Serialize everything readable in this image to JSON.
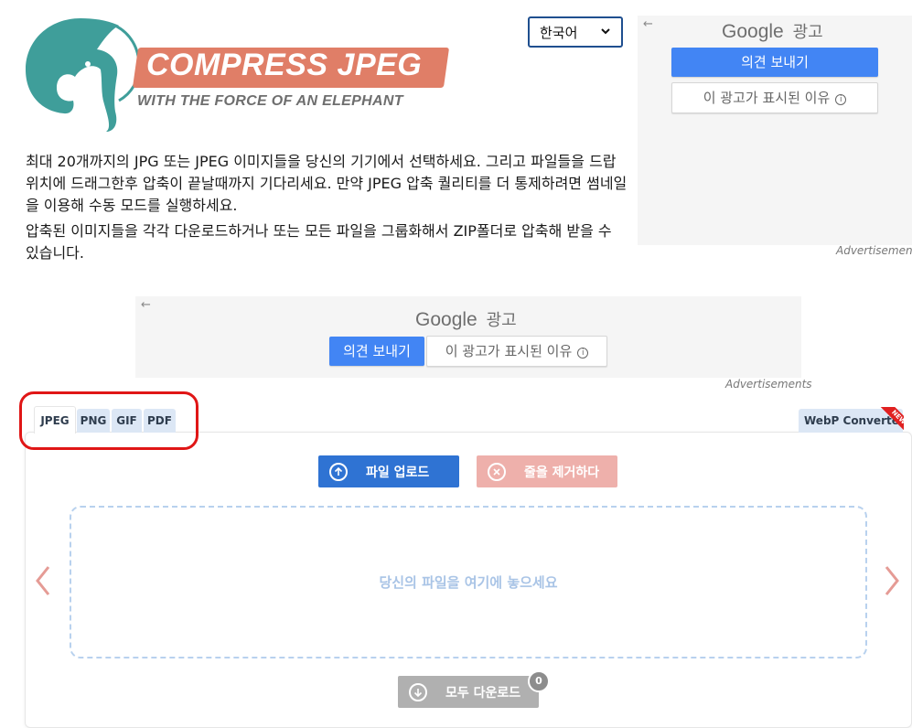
{
  "logo": {
    "title": "COMPRESS JPEG",
    "tagline": "WITH THE FORCE OF AN ELEPHANT",
    "icon": "elephant-logo",
    "colors": {
      "elephant": "#3f9e9a",
      "banner": "#e07e67"
    }
  },
  "language": {
    "selected": "한국어",
    "icon": "chevron-down-icon"
  },
  "ads": {
    "top": {
      "brand": "Google",
      "label": "광고",
      "feedback_button": "의견 보내기",
      "why_button": "이 광고가 표시된 이유",
      "info_icon": "ⓘ",
      "caption": "Advertisements"
    },
    "middle": {
      "brand": "Google",
      "label": "광고",
      "feedback_button": "의견 보내기",
      "why_button": "이 광고가 표시된 이유",
      "info_icon": "ⓘ",
      "caption": "Advertisements"
    }
  },
  "description": {
    "paragraph1": "최대 20개까지의 JPG 또는 JPEG 이미지들을 당신의 기기에서 선택하세요. 그리고 파일들을 드랍 위치에 드래그한후 압축이 끝날때까지 기다리세요. 만약 JPEG 압축 퀄리티를 더 통제하려면 썸네일을 이용해 수동 모드를 실행하세요.",
    "paragraph2": "압축된 이미지들을 각각 다운로드하거나 또는 모든 파일을 그룹화해서 ZIP폴더로 압축해 받을 수 있습니다."
  },
  "tabs": [
    {
      "label": "JPEG",
      "active": true
    },
    {
      "label": "PNG",
      "active": false
    },
    {
      "label": "GIF",
      "active": false
    },
    {
      "label": "PDF",
      "active": false
    }
  ],
  "webp_tab": {
    "label": "WebP Converter",
    "ribbon": "NEW"
  },
  "toolbar": {
    "upload_label": "파일 업로드",
    "clear_label": "줄을 제거하다",
    "download_all_label": "모두 다운로드",
    "download_count": "0"
  },
  "drop_zone": {
    "text": "당신의 파일을 여기에 놓으세요"
  },
  "colors": {
    "primary": "#2f73d3",
    "clear_disabled": "#eeb0ab",
    "download_disabled": "#b0b0b0",
    "tab_bg": "#dce7f5",
    "highlight": "#e01616",
    "arrow": "#e59b95"
  }
}
